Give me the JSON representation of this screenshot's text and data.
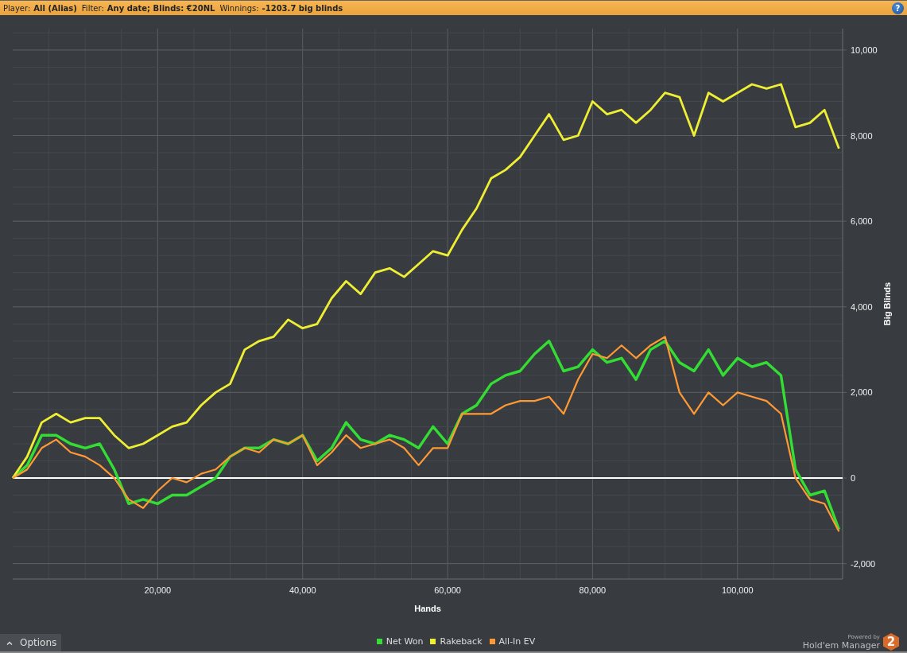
{
  "header": {
    "fields": [
      {
        "label": "Player:",
        "value": "All (Alias)"
      },
      {
        "label": "Filter:",
        "value": "Any date; Blinds: €20NL"
      },
      {
        "label": "Winnings:",
        "value": "-1203.7 big blinds"
      }
    ],
    "help_button": "?"
  },
  "chart_data": {
    "type": "line",
    "xlabel": "Hands",
    "ylabel": "Big Blinds",
    "x": [
      0,
      2000,
      4000,
      6000,
      8000,
      10000,
      12000,
      14000,
      16000,
      18000,
      20000,
      22000,
      24000,
      26000,
      28000,
      30000,
      32000,
      34000,
      36000,
      38000,
      40000,
      42000,
      44000,
      46000,
      48000,
      50000,
      52000,
      54000,
      56000,
      58000,
      60000,
      62000,
      64000,
      66000,
      68000,
      70000,
      72000,
      74000,
      76000,
      78000,
      80000,
      82000,
      84000,
      86000,
      88000,
      90000,
      92000,
      94000,
      96000,
      98000,
      100000,
      102000,
      104000,
      106000,
      108000,
      110000,
      112000,
      114000
    ],
    "series": [
      {
        "name": "Net Won",
        "color": "#33dd33",
        "values": [
          0,
          300,
          1000,
          1000,
          800,
          700,
          800,
          200,
          -600,
          -500,
          -600,
          -400,
          -400,
          -200,
          0,
          500,
          700,
          700,
          900,
          800,
          1000,
          400,
          700,
          1300,
          900,
          800,
          1000,
          900,
          700,
          1200,
          800,
          1500,
          1700,
          2200,
          2400,
          2500,
          2900,
          3200,
          2500,
          2600,
          3000,
          2700,
          2800,
          2300,
          3000,
          3200,
          2700,
          2500,
          3000,
          2400,
          2800,
          2600,
          2700,
          2400,
          200,
          -400,
          -300,
          -1200
        ]
      },
      {
        "name": "Rakeback",
        "color": "#eeee33",
        "values": [
          0,
          500,
          1300,
          1500,
          1300,
          1400,
          1400,
          1000,
          700,
          800,
          1000,
          1200,
          1300,
          1700,
          2000,
          2200,
          3000,
          3200,
          3300,
          3700,
          3500,
          3600,
          4200,
          4600,
          4300,
          4800,
          4900,
          4700,
          5000,
          5300,
          5200,
          5800,
          6300,
          7000,
          7200,
          7500,
          8000,
          8500,
          7900,
          8000,
          8800,
          8500,
          8600,
          8300,
          8600,
          9000,
          8900,
          8000,
          9000,
          8800,
          9000,
          9200,
          9100,
          9200,
          8200,
          8300,
          8600,
          7700
        ]
      },
      {
        "name": "All-In EV",
        "color": "#ff9933",
        "values": [
          0,
          200,
          700,
          900,
          600,
          500,
          300,
          0,
          -500,
          -700,
          -300,
          0,
          -100,
          100,
          200,
          500,
          700,
          600,
          900,
          800,
          1000,
          300,
          600,
          1000,
          700,
          800,
          900,
          700,
          300,
          700,
          700,
          1500,
          1500,
          1500,
          1700,
          1800,
          1800,
          1900,
          1500,
          2300,
          2900,
          2800,
          3100,
          2800,
          3100,
          3300,
          2000,
          1500,
          2000,
          1700,
          2000,
          1900,
          1800,
          1500,
          0,
          -500,
          -600,
          -1250
        ]
      }
    ],
    "grid": true,
    "xlim": [
      0,
      114500
    ],
    "ylim": [
      -2360,
      10500
    ],
    "xticks": [
      {
        "value": 20000,
        "label": "20,000"
      },
      {
        "value": 40000,
        "label": "40,000"
      },
      {
        "value": 60000,
        "label": "60,000"
      },
      {
        "value": 80000,
        "label": "80,000"
      },
      {
        "value": 100000,
        "label": "100,000"
      }
    ],
    "yticks": [
      {
        "value": -2000,
        "label": "-2,000"
      },
      {
        "value": 0,
        "label": "0"
      },
      {
        "value": 2000,
        "label": "2,000"
      },
      {
        "value": 4000,
        "label": "4,000"
      },
      {
        "value": 6000,
        "label": "6,000"
      },
      {
        "value": 8000,
        "label": "8,000"
      },
      {
        "value": 10000,
        "label": "10,000"
      }
    ]
  },
  "footer": {
    "options_button": "Options",
    "powered_by": "Powered by",
    "product_name": "Hold'em Manager",
    "logo_badge": "2"
  }
}
